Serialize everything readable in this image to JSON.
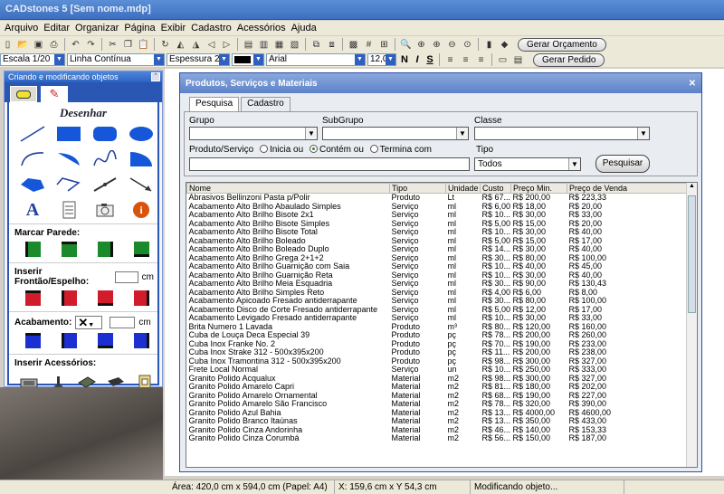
{
  "window": {
    "title": "CADstones 5  [Sem nome.mdp]"
  },
  "menu": [
    "Arquivo",
    "Editar",
    "Organizar",
    "Página",
    "Exibir",
    "Cadastro",
    "Acessórios",
    "Ajuda"
  ],
  "toolbar": {
    "btn_orcamento": "Gerar Orçamento",
    "btn_pedido": "Gerar Pedido",
    "scale": "Escala 1/20",
    "line_style": "Linha Contínua",
    "thickness": "Espessura 2",
    "font": "Arial",
    "font_size": "12,0",
    "bold": "N",
    "italic": "I",
    "underline": "S"
  },
  "left_panel": {
    "title": "Criando e modificando objetos",
    "section_draw": "Desenhar",
    "marcar_parede": "Marcar Parede:",
    "inserir_frontao": "Inserir Frontão/Espelho:",
    "acabamento": "Acabamento:",
    "unit": "cm",
    "inserir_acessorios": "Inserir Acessórios:"
  },
  "dialog": {
    "title": "Produtos, Serviços e Materiais",
    "tabs": [
      "Pesquisa",
      "Cadastro"
    ],
    "grupo": "Grupo",
    "subgrupo": "SubGrupo",
    "classe": "Classe",
    "produto_servico": "Produto/Serviço",
    "radio_inicia": "Inicia ou",
    "radio_contem": "Contém ou",
    "radio_termina": "Termina com",
    "tipo": "Tipo",
    "tipo_value": "Todos",
    "pesquisar": "Pesquisar",
    "columns": [
      "Nome",
      "Tipo",
      "Unidade",
      "Custo",
      "Preço Min.",
      "Preço de Venda"
    ],
    "rows": [
      [
        "Abrasivos Bellinzoni Pasta p/Polir",
        "Produto",
        "Lt",
        "R$ 67...",
        "R$ 200,00",
        "R$ 223,33"
      ],
      [
        "Acabamento Alto Brilho Abaulado Simples",
        "Serviço",
        "ml",
        "R$ 6,00",
        "R$ 18,00",
        "R$ 20,00"
      ],
      [
        "Acabamento Alto Brilho Bisote 2x1",
        "Serviço",
        "ml",
        "R$ 10...",
        "R$ 30,00",
        "R$ 33,00"
      ],
      [
        "Acabamento Alto Brilho Bisote Simples",
        "Serviço",
        "ml",
        "R$ 5,00",
        "R$ 15,00",
        "R$ 20,00"
      ],
      [
        "Acabamento Alto Brilho Bisote Total",
        "Serviço",
        "ml",
        "R$ 10...",
        "R$ 30,00",
        "R$ 40,00"
      ],
      [
        "Acabamento Alto Brilho Boleado",
        "Serviço",
        "ml",
        "R$ 5,00",
        "R$ 15,00",
        "R$ 17,00"
      ],
      [
        "Acabamento Alto Brilho Boleado Duplo",
        "Serviço",
        "ml",
        "R$ 14...",
        "R$ 30,00",
        "R$ 40,00"
      ],
      [
        "Acabamento Alto Brilho Grega 2+1+2",
        "Serviço",
        "ml",
        "R$ 30...",
        "R$ 80,00",
        "R$ 100,00"
      ],
      [
        "Acabamento Alto Brilho Guarnição com Saia",
        "Serviço",
        "ml",
        "R$ 10...",
        "R$ 40,00",
        "R$ 45,00"
      ],
      [
        "Acabamento Alto Brilho Guarnição Reta",
        "Serviço",
        "ml",
        "R$ 10...",
        "R$ 30,00",
        "R$ 40,00"
      ],
      [
        "Acabamento Alto Brilho Meia Esquadria",
        "Serviço",
        "ml",
        "R$ 30...",
        "R$ 90,00",
        "R$ 130,43"
      ],
      [
        "Acabamento Alto Brilho Simples Reto",
        "Serviço",
        "ml",
        "R$ 4,00",
        "R$ 6,00",
        "R$ 8,00"
      ],
      [
        "Acabamento Apicoado Fresado antiderrapante",
        "Serviço",
        "ml",
        "R$ 30...",
        "R$ 80,00",
        "R$ 100,00"
      ],
      [
        "Acabamento Disco de Corte Fresado antiderrapante",
        "Serviço",
        "ml",
        "R$ 5,00",
        "R$ 12,00",
        "R$ 17,00"
      ],
      [
        "Acabamento Levigado Fresado antiderrapante",
        "Serviço",
        "ml",
        "R$ 10...",
        "R$ 30,00",
        "R$ 33,00"
      ],
      [
        "Brita Numero 1 Lavada",
        "Produto",
        "m³",
        "R$ 80...",
        "R$ 120,00",
        "R$ 160,00"
      ],
      [
        "Cuba de Louça Deca Especial 39",
        "Produto",
        "pç",
        "R$ 78...",
        "R$ 200,00",
        "R$ 260,00"
      ],
      [
        "Cuba Inox Franke No. 2",
        "Produto",
        "pç",
        "R$ 70...",
        "R$ 190,00",
        "R$ 233,00"
      ],
      [
        "Cuba Inox Strake 312 - 500x395x200",
        "Produto",
        "pç",
        "R$ 11...",
        "R$ 200,00",
        "R$ 238,00"
      ],
      [
        "Cuba Inox Tramontina 312 - 500x395x200",
        "Produto",
        "pç",
        "R$ 98...",
        "R$ 300,00",
        "R$ 327,00"
      ],
      [
        "Frete Local Normal",
        "Serviço",
        "un",
        "R$ 10...",
        "R$ 250,00",
        "R$ 333,00"
      ],
      [
        "Granito Polido Acqualux",
        "Material",
        "m2",
        "R$ 98...",
        "R$ 300,00",
        "R$ 327,00"
      ],
      [
        "Granito Polido Amarelo Capri",
        "Material",
        "m2",
        "R$ 81...",
        "R$ 180,00",
        "R$ 202,00"
      ],
      [
        "Granito Polido Amarelo Ornamental",
        "Material",
        "m2",
        "R$ 68...",
        "R$ 190,00",
        "R$ 227,00"
      ],
      [
        "Granito Polido Amarelo São Francisco",
        "Material",
        "m2",
        "R$ 78...",
        "R$ 320,00",
        "R$ 390,00"
      ],
      [
        "Granito Polido Azul Bahia",
        "Material",
        "m2",
        "R$ 13...",
        "R$ 4000,00",
        "R$ 4600,00"
      ],
      [
        "Granito Polido Branco Itaúnas",
        "Material",
        "m2",
        "R$ 13...",
        "R$ 350,00",
        "R$ 433,00"
      ],
      [
        "Granito Polido Cinza Andorinha",
        "Material",
        "m2",
        "R$ 46...",
        "R$ 140,00",
        "R$ 153,33"
      ],
      [
        "Granito Polido Cinza Corumbá",
        "Material",
        "m2",
        "R$ 56...",
        "R$ 150,00",
        "R$ 187,00"
      ]
    ]
  },
  "status": {
    "area": "Área: 420,0 cm  x  594,0 cm  (Papel: A4)",
    "coords": "X: 159,6 cm  x  Y  54,3 cm",
    "message": "Modificando objeto..."
  },
  "colors": {
    "wall_green": "#1a8a2a",
    "frontao_red": "#d11c2c",
    "acab_blue": "#1c2fd0",
    "title_blue": "#3d6fc0"
  }
}
